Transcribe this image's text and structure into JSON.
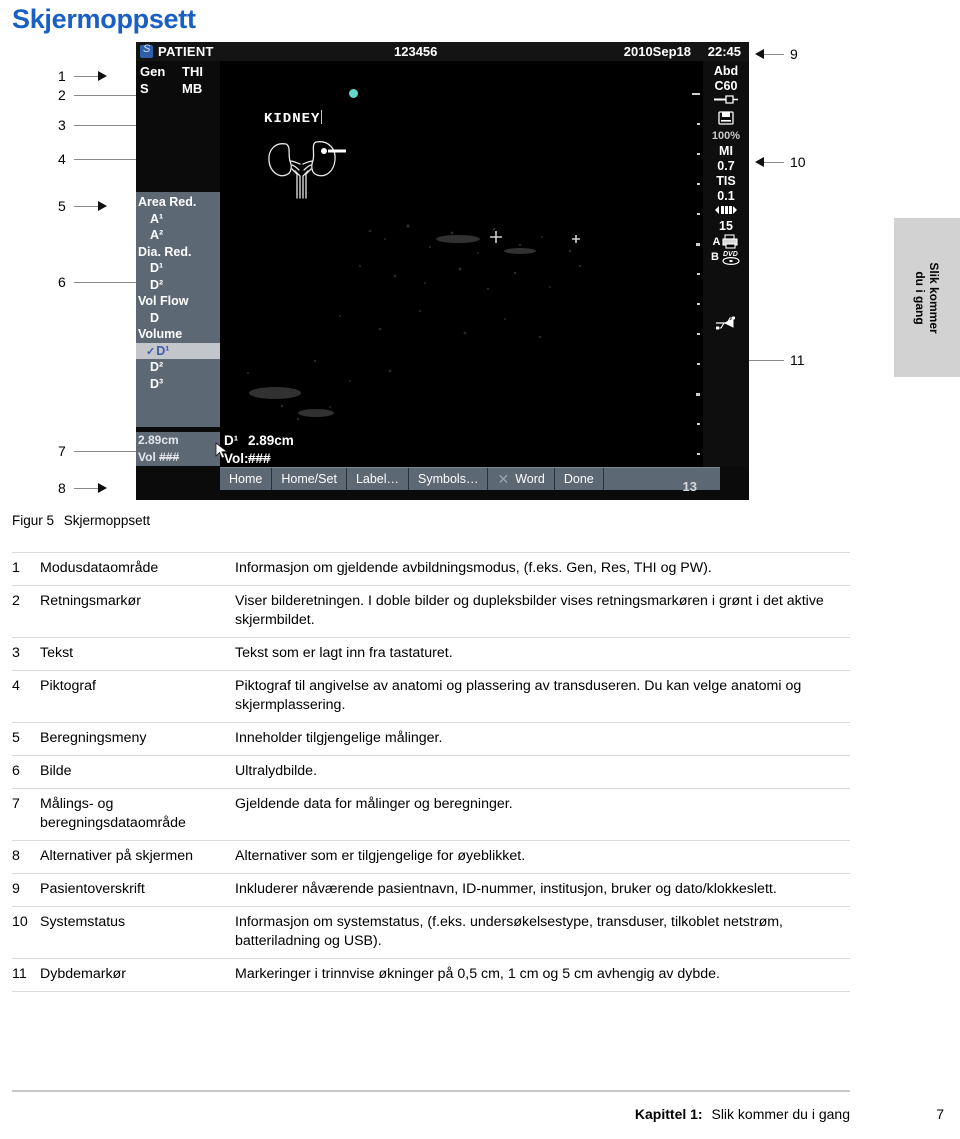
{
  "document": {
    "title": "Skjermoppsett",
    "figure_caption_label": "Figur 5",
    "figure_caption_text": "Skjermoppsett",
    "side_tab": "Slik kommer\ndu i gang",
    "footer_chapter": "Kapittel 1:",
    "footer_title": "Slik kommer du i gang",
    "footer_page": "7"
  },
  "colors": {
    "title_blue": "#1a5fc4",
    "menu_slate": "#5d6875",
    "selected_row_bg": "#c3c7cc",
    "selected_row_text": "#3e5ba9",
    "orientation_dot": "#62d6c8",
    "side_tab_bg": "#d2d2d2",
    "screen_bg": "#0b0b0b"
  },
  "ultrasound": {
    "header": {
      "logo_icon": "sonosite-logo-icon",
      "patient_label": "PATIENT",
      "patient_id": "123456",
      "date": "2010Sep18",
      "time": "22:45"
    },
    "mode_data": {
      "row1_col1": "Gen",
      "row1_col2": "THI",
      "row2_col1": "S",
      "row2_col2": "MB"
    },
    "text_annotation": "KIDNEY",
    "pictogram_name": "kidney-pictogram",
    "calc_menu": [
      {
        "label": "Area Red.",
        "indent": false,
        "selected": false
      },
      {
        "label": "A¹",
        "indent": true,
        "selected": false
      },
      {
        "label": "A²",
        "indent": true,
        "selected": false
      },
      {
        "label": "Dia. Red.",
        "indent": false,
        "selected": false
      },
      {
        "label": "D¹",
        "indent": true,
        "selected": false
      },
      {
        "label": "D²",
        "indent": true,
        "selected": false
      },
      {
        "label": "Vol Flow",
        "indent": false,
        "selected": false
      },
      {
        "label": "D",
        "indent": true,
        "selected": false
      },
      {
        "label": "Volume",
        "indent": false,
        "selected": false
      },
      {
        "label": "D¹",
        "indent": true,
        "selected": true
      },
      {
        "label": "D²",
        "indent": true,
        "selected": false
      },
      {
        "label": "D³",
        "indent": true,
        "selected": false
      }
    ],
    "measurement_side": {
      "line1": "2.89cm",
      "line2_label": "Vol",
      "line2_value": "###"
    },
    "measurement_main": {
      "line1_label": "D¹",
      "line1_value": "2.89cm",
      "line2_label": "Vol:",
      "line2_value": "###"
    },
    "option_bar": [
      {
        "label": "Home",
        "icon": ""
      },
      {
        "label": "Home/Set",
        "icon": ""
      },
      {
        "label": "Label…",
        "icon": ""
      },
      {
        "label": "Symbols…",
        "icon": ""
      },
      {
        "label": "Word",
        "icon": "close-x-icon"
      },
      {
        "label": "Done",
        "icon": ""
      }
    ],
    "status_column": [
      {
        "value": "Abd",
        "type": "text"
      },
      {
        "value": "C60",
        "type": "text"
      },
      {
        "value": "transducer-icon",
        "type": "icon"
      },
      {
        "value": "save-disk-icon",
        "type": "icon"
      },
      {
        "value": "100%",
        "type": "small"
      },
      {
        "value": "MI",
        "type": "text"
      },
      {
        "value": "0.7",
        "type": "text"
      },
      {
        "value": "TIS",
        "type": "text"
      },
      {
        "value": "0.1",
        "type": "text"
      },
      {
        "value": "battery-icon",
        "type": "icon"
      },
      {
        "value": "15",
        "type": "text"
      },
      {
        "value": "A printer-icon",
        "type": "icon"
      },
      {
        "value": "B dvd-icon",
        "type": "icon"
      },
      {
        "value": "usb-icon",
        "type": "icon"
      }
    ],
    "depth_marker_value": "13"
  },
  "callouts": [
    {
      "num": "1"
    },
    {
      "num": "2"
    },
    {
      "num": "3"
    },
    {
      "num": "4"
    },
    {
      "num": "5"
    },
    {
      "num": "6"
    },
    {
      "num": "7"
    },
    {
      "num": "8"
    },
    {
      "num": "9"
    },
    {
      "num": "10"
    },
    {
      "num": "11"
    }
  ],
  "table": {
    "rows": [
      {
        "num": "1",
        "name": "Modusdataområde",
        "desc": "Informasjon om gjeldende avbildningsmodus, (f.eks. Gen, Res, THI og PW)."
      },
      {
        "num": "2",
        "name": "Retningsmarkør",
        "desc": "Viser bilderetningen. I doble bilder og dupleksbilder vises retningsmarkøren i grønt i det aktive skjermbildet."
      },
      {
        "num": "3",
        "name": "Tekst",
        "desc": "Tekst som er lagt inn fra tastaturet."
      },
      {
        "num": "4",
        "name": "Piktograf",
        "desc": "Piktograf til angivelse av anatomi og plassering av transduseren. Du kan velge anatomi og skjermplassering."
      },
      {
        "num": "5",
        "name": "Beregningsmeny",
        "desc": "Inneholder tilgjengelige målinger."
      },
      {
        "num": "6",
        "name": "Bilde",
        "desc": "Ultralydbilde."
      },
      {
        "num": "7",
        "name": "Målings- og beregningsdataområde",
        "desc": "Gjeldende data for målinger og beregninger."
      },
      {
        "num": "8",
        "name": "Alternativer på skjermen",
        "desc": "Alternativer som er tilgjengelige for øyeblikket."
      },
      {
        "num": "9",
        "name": "Pasientoverskrift",
        "desc": "Inkluderer nåværende pasientnavn, ID-nummer, institusjon, bruker og dato/klokkeslett."
      },
      {
        "num": "10",
        "name": "Systemstatus",
        "desc": "Informasjon om systemstatus, (f.eks. undersøkelsestype, transduser, tilkoblet netstrøm, batteriladning og USB)."
      },
      {
        "num": "11",
        "name": "Dybdemarkør",
        "desc": "Markeringer i trinnvise økninger på 0,5 cm, 1 cm og 5 cm avhengig av dybde."
      }
    ]
  }
}
